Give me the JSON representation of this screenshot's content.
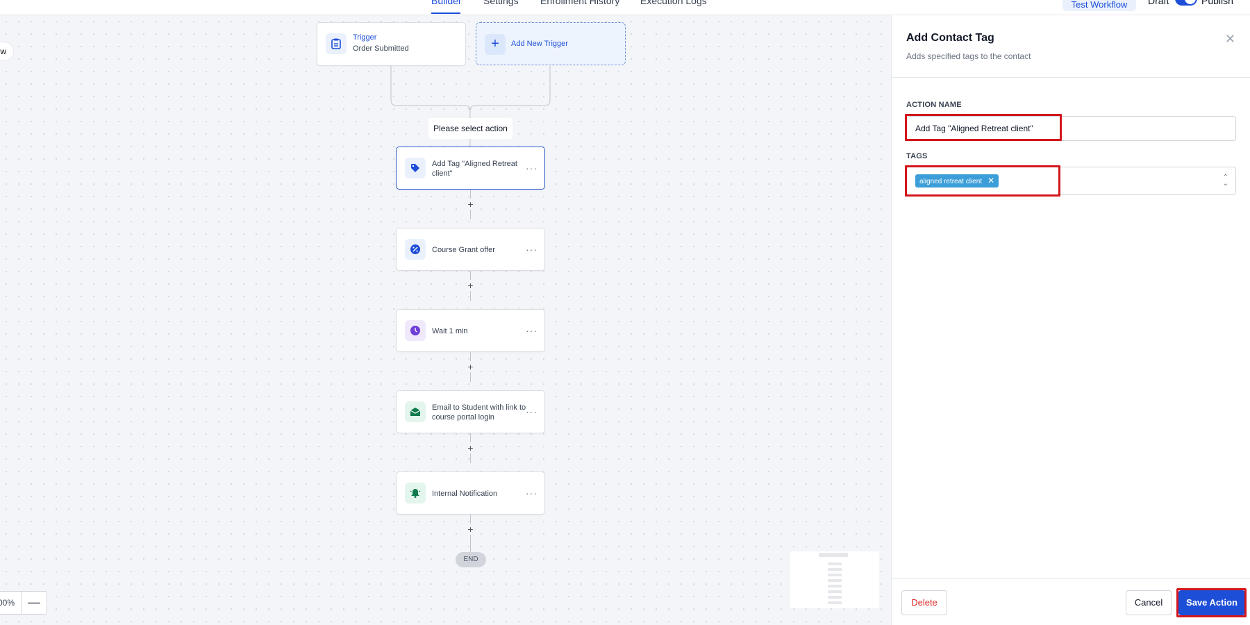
{
  "header": {
    "tabs": [
      {
        "label": "Builder",
        "active": true
      },
      {
        "label": "Settings",
        "active": false
      },
      {
        "label": "Enrollment History",
        "active": false
      },
      {
        "label": "Execution Logs",
        "active": false
      }
    ],
    "test_button": "Test Workflow",
    "draft_label": "Draft",
    "publish_label": "Publish"
  },
  "canvas": {
    "left_pill_text": "w",
    "trigger": {
      "title": "Trigger",
      "subtitle": "Order Submitted",
      "icon": "clipboard-icon"
    },
    "add_trigger_label": "Add New Trigger",
    "select_action_label": "Please select action",
    "actions": [
      {
        "label": "Add Tag \"Aligned Retreat client\"",
        "icon": "tag-icon",
        "selected": true
      },
      {
        "label": "Course Grant offer",
        "icon": "percent-badge-icon"
      },
      {
        "label": "Wait 1 min",
        "icon": "clock-icon"
      },
      {
        "label": "Email to Student with link to course portal login",
        "icon": "envelope-icon"
      },
      {
        "label": "Internal Notification",
        "icon": "bell-icon"
      }
    ],
    "plus_symbol": "+",
    "end_label": "END",
    "zoom_value": "00%",
    "zoom_minus": "—"
  },
  "panel": {
    "title": "Add Contact Tag",
    "subtitle": "Adds specified tags to the contact",
    "action_name_label": "ACTION NAME",
    "action_name_value": "Add Tag \"Aligned Retreat client\"",
    "tags_label": "TAGS",
    "tags": [
      "aligned retreat client"
    ],
    "delete_button": "Delete",
    "cancel_button": "Cancel",
    "save_button": "Save Action"
  },
  "colors": {
    "accent": "#1d4ed8",
    "highlight": "#d3161c",
    "tag_chip": "#3b9ed8",
    "delete": "#dc2626"
  }
}
